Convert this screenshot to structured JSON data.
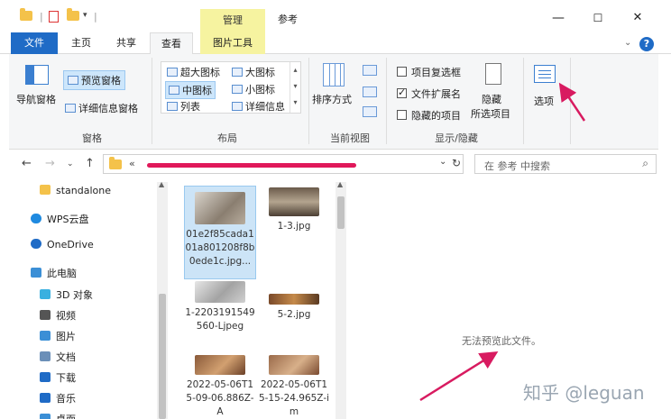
{
  "titlebar": {
    "context_tab": "管理",
    "title": "参考",
    "minimize": "—",
    "maximize": "☐",
    "close": "✕"
  },
  "tabs": {
    "file": "文件",
    "home": "主页",
    "share": "共享",
    "view": "查看",
    "picture_tools": "图片工具"
  },
  "help": "?",
  "ribbon": {
    "panes": {
      "nav_pane": "导航窗格",
      "preview_pane": "预览窗格",
      "details_pane": "详细信息窗格",
      "label": "窗格"
    },
    "layout": {
      "extra_large": "超大图标",
      "large": "大图标",
      "medium": "中图标",
      "small": "小图标",
      "list": "列表",
      "details": "详细信息",
      "label": "布局"
    },
    "current_view": {
      "sort_by": "排序方式",
      "label": "当前视图"
    },
    "show_hide": {
      "item_checkboxes": "项目复选框",
      "file_extensions": "文件扩展名",
      "file_extensions_checked": true,
      "hidden_items": "隐藏的项目",
      "hide": "隐藏",
      "selected_items": "所选项目",
      "label": "显示/隐藏"
    },
    "options": "选项"
  },
  "address": {
    "prefix": "«",
    "search_placeholder": "在 参考 中搜索"
  },
  "nav_items": [
    {
      "label": "standalone",
      "icon": "folder-icon",
      "color": "#f4c24a"
    },
    {
      "label": "WPS云盘",
      "icon": "cloud-icon",
      "color": "#1f8ae0"
    },
    {
      "label": "OneDrive",
      "icon": "cloud-icon",
      "color": "#1f6bc6"
    },
    {
      "label": "此电脑",
      "icon": "computer-icon",
      "color": "#3b8fd6"
    },
    {
      "label": "3D 对象",
      "icon": "cube-icon",
      "color": "#3ab0e0"
    },
    {
      "label": "视频",
      "icon": "video-icon",
      "color": "#555555"
    },
    {
      "label": "图片",
      "icon": "picture-icon",
      "color": "#3b8fd6"
    },
    {
      "label": "文档",
      "icon": "document-icon",
      "color": "#6b8fb8"
    },
    {
      "label": "下载",
      "icon": "download-icon",
      "color": "#1f6bc6"
    },
    {
      "label": "音乐",
      "icon": "music-icon",
      "color": "#1f6bc6"
    },
    {
      "label": "桌面",
      "icon": "desktop-icon",
      "color": "#3b8fd6"
    }
  ],
  "files": [
    {
      "name": "01e2f85cada101a801208f8b0ede1c.jpg...",
      "selected": true
    },
    {
      "name": "1-3.jpg",
      "selected": false
    },
    {
      "name": "1-2203191549560-Ljpeg",
      "selected": false
    },
    {
      "name": "5-2.jpg",
      "selected": false
    },
    {
      "name": "2022-05-06T15-09-06.886Z-A",
      "selected": false
    },
    {
      "name": "2022-05-06T15-15-24.965Z-im",
      "selected": false
    }
  ],
  "preview": {
    "no_preview": "无法预览此文件。"
  },
  "watermark": "知乎 @leguan"
}
